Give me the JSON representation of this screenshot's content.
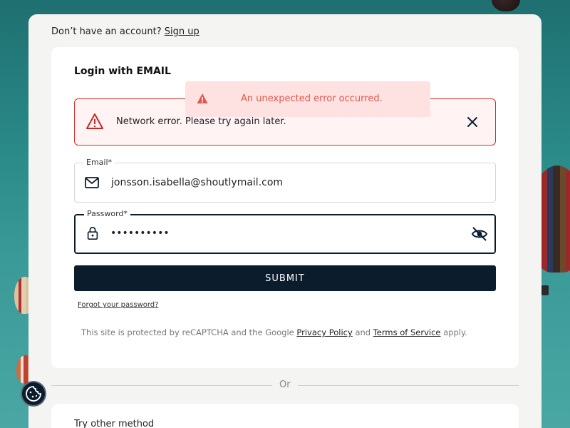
{
  "signup": {
    "prompt": "Don’t have an account?",
    "link": "Sign up"
  },
  "login": {
    "title": "Login with EMAIL",
    "toast": "An unexpected error occurred.",
    "alert": "Network error. Please try again later.",
    "email": {
      "label": "Email*",
      "value": "jonsson.isabella@shoutlymail.com"
    },
    "password": {
      "label": "Password*",
      "value": "••••••••••"
    },
    "submit": "SUBMIT",
    "forgot": "Forgot your password?",
    "recaptcha": {
      "prefix": "This site is protected by reCAPTCHA and the Google",
      "privacy": "Privacy Policy",
      "and": "and",
      "terms": "Terms of Service",
      "suffix": "apply."
    }
  },
  "separator": "Or",
  "other_method": "Try other method",
  "colors": {
    "primary": "#0b1d2d",
    "error": "#d33030",
    "toast_bg": "#fde2e1",
    "toast_text": "#e4574e"
  },
  "icons": {
    "toast": "warning-icon",
    "alert": "warning-icon",
    "close": "close-icon",
    "email": "envelope-icon",
    "password": "lock-icon",
    "visibility": "eye-off-icon",
    "cookie": "cookie-icon"
  }
}
